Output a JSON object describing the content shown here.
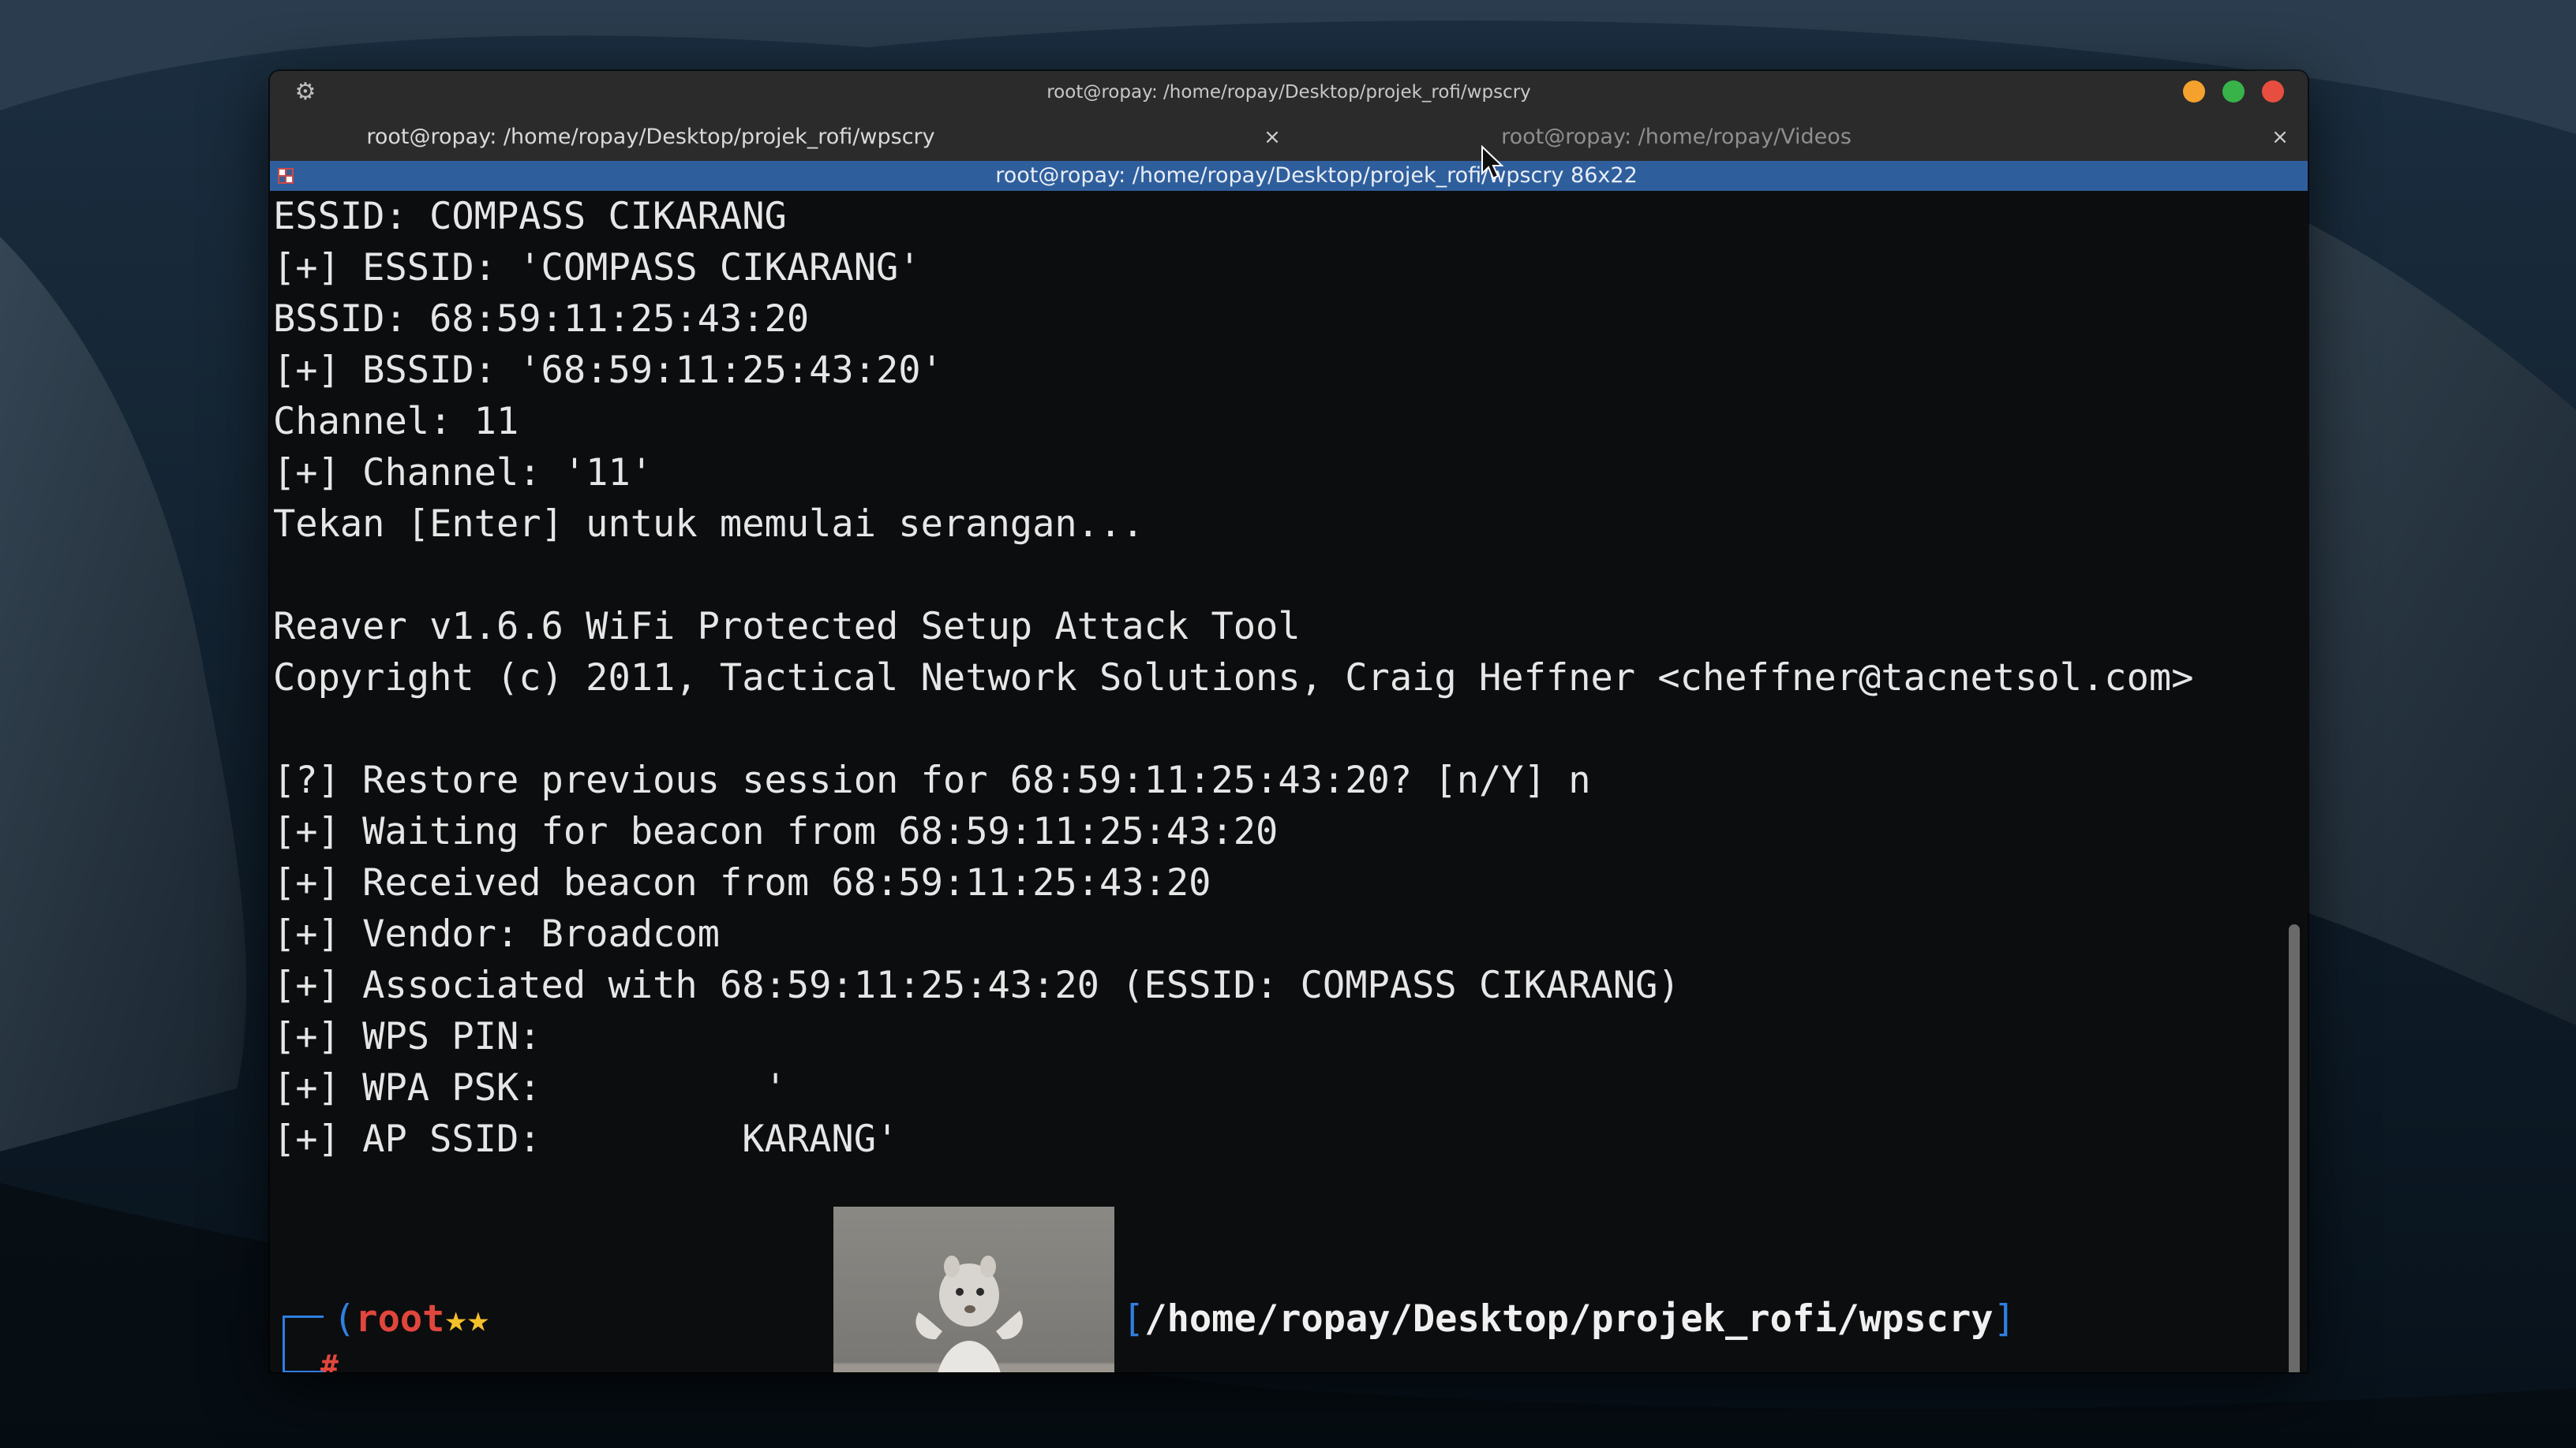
{
  "window": {
    "title": "root@ropay: /home/ropay/Desktop/projek_rofi/wpscry"
  },
  "tabs": [
    {
      "label": "root@ropay: /home/ropay/Desktop/projek_rofi/wpscry",
      "close": "×",
      "active": true
    },
    {
      "label": "root@ropay: /home/ropay/Videos",
      "close": "×",
      "active": false
    }
  ],
  "terminal_header": {
    "text": "root@ropay: /home/ropay/Desktop/projek_rofi/wpscry 86x22"
  },
  "output": {
    "lines": [
      "ESSID: COMPASS CIKARANG",
      "[+] ESSID: 'COMPASS CIKARANG'",
      "BSSID: 68:59:11:25:43:20",
      "[+] BSSID: '68:59:11:25:43:20'",
      "Channel: 11",
      "[+] Channel: '11'",
      "Tekan [Enter] untuk memulai serangan...",
      "",
      "Reaver v1.6.6 WiFi Protected Setup Attack Tool",
      "Copyright (c) 2011, Tactical Network Solutions, Craig Heffner <cheffner@tacnetsol.com>",
      "",
      "[?] Restore previous session for 68:59:11:25:43:20? [n/Y] n",
      "[+] Waiting for beacon from 68:59:11:25:43:20",
      "[+] Received beacon from 68:59:11:25:43:20",
      "[+] Vendor: Broadcom",
      "[+] Associated with 68:59:11:25:43:20 (ESSID: COMPASS CIKARANG)",
      "[+] WPS PIN:",
      "[+] WPA PSK:          '",
      "[+] AP SSID:         KARANG'"
    ]
  },
  "prompt": {
    "open_paren": "(",
    "user": "root",
    "stars": "★★",
    "path_open": "[",
    "path": "/home/ropay/Desktop/projek_rofi/wpscry",
    "path_close": "]",
    "symbol": "#"
  },
  "icons": {
    "settings": "gear-icon",
    "terminal": "terminal-icon",
    "pointer": "mouse-pointer-icon"
  },
  "colors": {
    "header_bar": "#2f5e9c",
    "prompt_user": "#e0463c",
    "prompt_bracket": "#2f7fe0",
    "btn_minimize": "#f4a22d",
    "btn_maximize": "#38b34a",
    "btn_close": "#e84e3f"
  }
}
